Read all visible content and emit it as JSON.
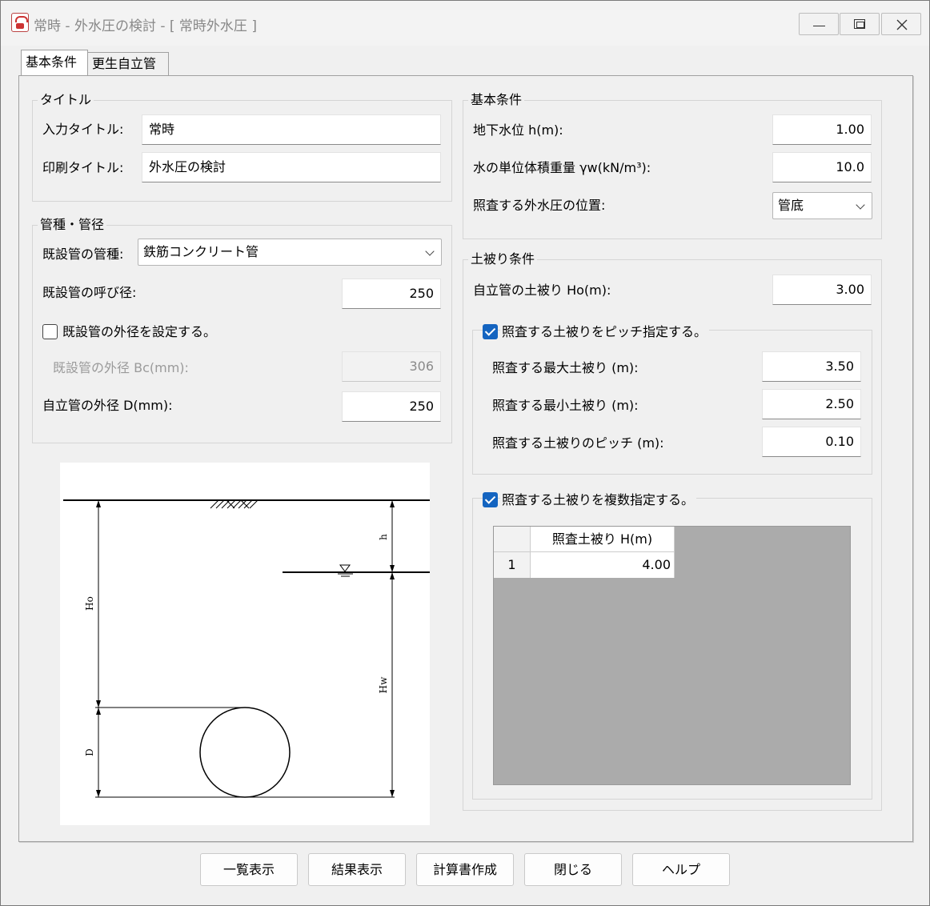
{
  "window": {
    "title": "常時 - 外水圧の検討 - [ 常時外水圧 ]",
    "minimize": "minimize",
    "maximize": "maximize",
    "close": "close"
  },
  "tabs": [
    {
      "label": "基本条件",
      "active": true
    },
    {
      "label": "更生自立管",
      "active": false
    }
  ],
  "title_group": {
    "title": "タイトル",
    "input_title_label": "入力タイトル:",
    "input_title_value": "常時",
    "print_title_label": "印刷タイトル:",
    "print_title_value": "外水圧の検討"
  },
  "pipe_group": {
    "title": "管種・管径",
    "pipe_type_label": "既設管の管種:",
    "pipe_type_value": "鉄筋コンクリート管",
    "nominal_diameter_label": "既設管の呼び径:",
    "nominal_diameter_value": "250",
    "set_outer_diameter_label": "既設管の外径を設定する。",
    "set_outer_diameter_checked": false,
    "outer_diameter_bc_label": "既設管の外径 Bc(mm):",
    "outer_diameter_bc_value": "306",
    "self_pipe_outer_label": "自立管の外径 D(mm):",
    "self_pipe_outer_value": "250"
  },
  "basic_group": {
    "title": "基本条件",
    "groundwater_label": "地下水位 h(m):",
    "groundwater_value": "1.00",
    "unit_weight_label": "水の単位体積重量 γw(kN/m³):",
    "unit_weight_value": "10.0",
    "pressure_position_label": "照査する外水圧の位置:",
    "pressure_position_value": "管底"
  },
  "cover_group": {
    "title": "土被り条件",
    "self_cover_label": "自立管の土被り Ho(m):",
    "self_cover_value": "3.00",
    "pitch_group": {
      "label": "照査する土被りをピッチ指定する。",
      "checked": true,
      "max_label": "照査する最大土被り (m):",
      "max_value": "3.50",
      "min_label": "照査する最小土被り (m):",
      "min_value": "2.50",
      "pitch_label": "照査する土被りのピッチ (m):",
      "pitch_value": "0.10"
    },
    "multi_group": {
      "label": "照査する土被りを複数指定する。",
      "checked": true,
      "column_header": "照査土被り H(m)",
      "rows": [
        {
          "index": "1",
          "value": "4.00"
        }
      ]
    }
  },
  "diagram": {
    "label_h": "h",
    "label_ho": "Ho",
    "label_hw": "Hw",
    "label_d": "D"
  },
  "buttons": {
    "list": "一覧表示",
    "result": "結果表示",
    "report": "計算書作成",
    "close": "閉じる",
    "help": "ヘルプ"
  }
}
